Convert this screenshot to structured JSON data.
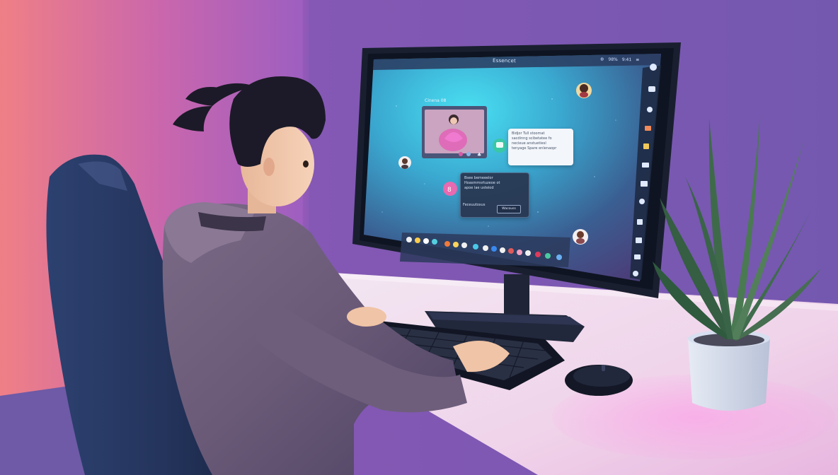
{
  "screen": {
    "menu_title": "Essencet",
    "menu_status": [
      "⚙",
      "98%",
      "9:41",
      "≡"
    ],
    "video_window_label": "Cinena 08",
    "chat_card_light": {
      "lines": [
        "Bidjor Tull stoomat",
        "sacdinng scibetatee fo",
        "necieue anstuetiesl",
        "tenyage Spare enlenaopr"
      ]
    },
    "chat_card_dark": {
      "lines": [
        "Bsee bemeeelor",
        "Hoasmmsrtuzeoe ot",
        "apoe lae usteiod"
      ],
      "footer": "Feceuutoxus",
      "button": "Wacouss"
    }
  },
  "colors": {
    "wall_left": "#e87a8e",
    "wall_right": "#7a5cb8",
    "screen_glow": "#3fd6f0",
    "desk": "#f0dcec",
    "chair": "#2a3a64"
  }
}
